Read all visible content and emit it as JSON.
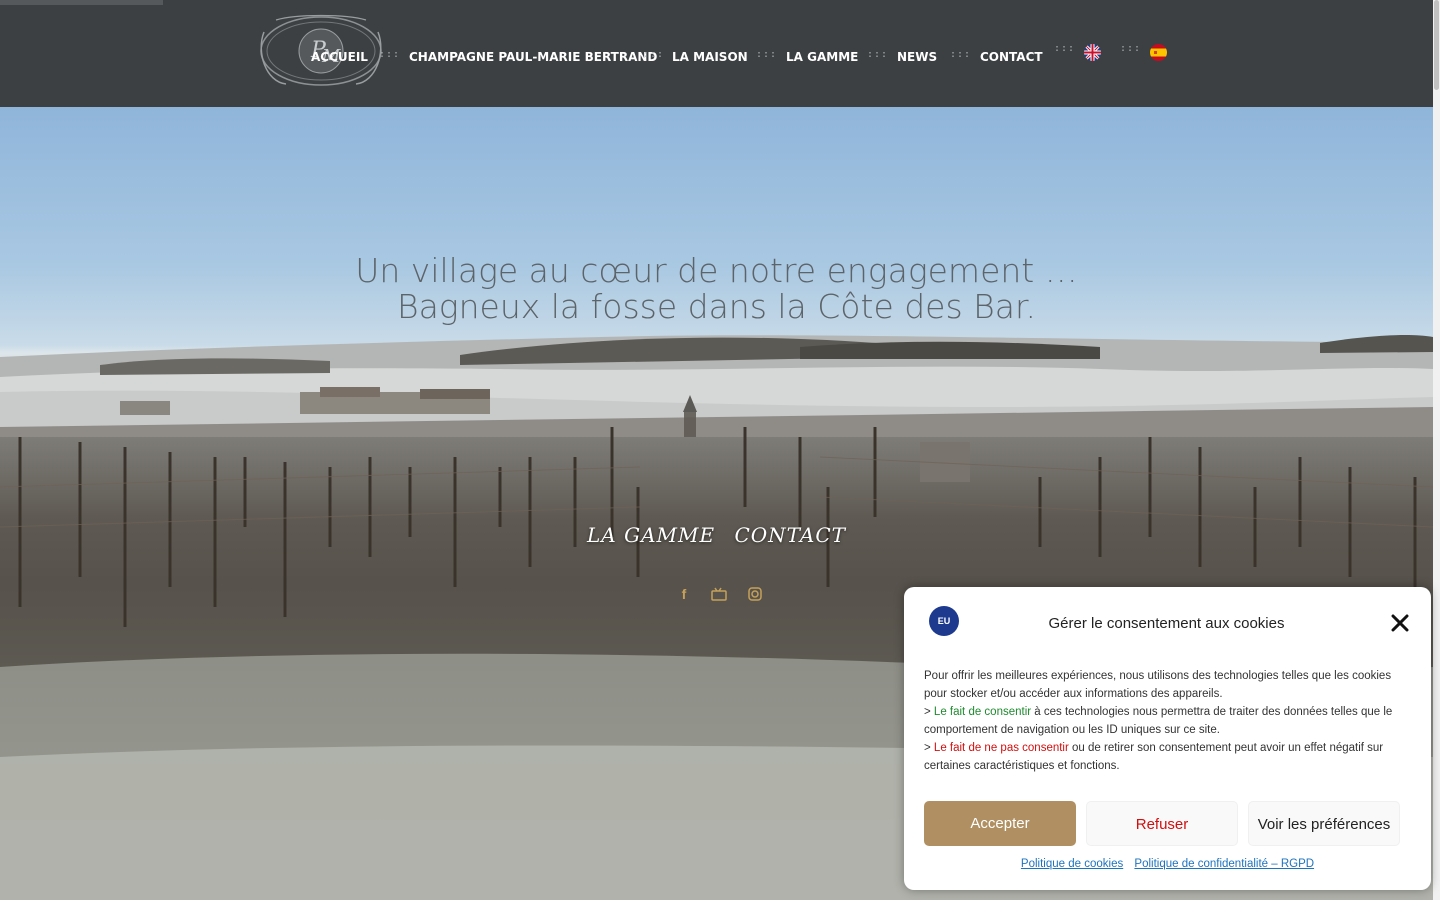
{
  "header": {
    "logo_alt": "Paul-Marie Bertrand",
    "nav": [
      {
        "label": "ACCUEIL"
      },
      {
        "label": "CHAMPAGNE PAUL-MARIE BERTRAND"
      },
      {
        "label": "LA MAISON"
      },
      {
        "label": "LA GAMME"
      },
      {
        "label": "NEWS"
      },
      {
        "label": "CONTACT"
      }
    ],
    "separator": ":::",
    "languages": [
      "en",
      "es"
    ]
  },
  "hero": {
    "title_line1": "Un village au cœur de notre engagement …",
    "title_line2": "Bagneux la fosse dans la Côte des Bar.",
    "link1": "LA GAMME",
    "link2": "CONTACT",
    "social": [
      "facebook-icon",
      "youtube-icon",
      "instagram-icon"
    ]
  },
  "cookie": {
    "badge": "EU",
    "title": "Gérer le consentement aux cookies",
    "intro": "Pour offrir les meilleures expériences, nous utilisons des technologies telles que les cookies pour stocker et/ou accéder aux informations des appareils.",
    "consent_prefix": "> ",
    "consent_highlight": "Le fait de consentir",
    "consent_rest": " à ces technologies nous permettra de traiter des données telles que le comportement de navigation ou les ID uniques sur ce site.",
    "refuse_prefix": "> ",
    "refuse_highlight": "Le fait de ne pas consentir",
    "refuse_rest": " ou de retirer son consentement peut avoir un effet négatif sur certaines caractéristiques et fonctions.",
    "accept_label": "Accepter",
    "refuse_label": "Refuser",
    "prefs_label": "Voir les préférences",
    "link_cookies": "Politique de cookies",
    "link_privacy": "Politique de confidentialité – RGPD"
  },
  "colors": {
    "header_bg": "#3c4043",
    "accent": "#b08f62",
    "consent_green": "#1e8a2e",
    "refuse_red": "#d10f0f"
  }
}
